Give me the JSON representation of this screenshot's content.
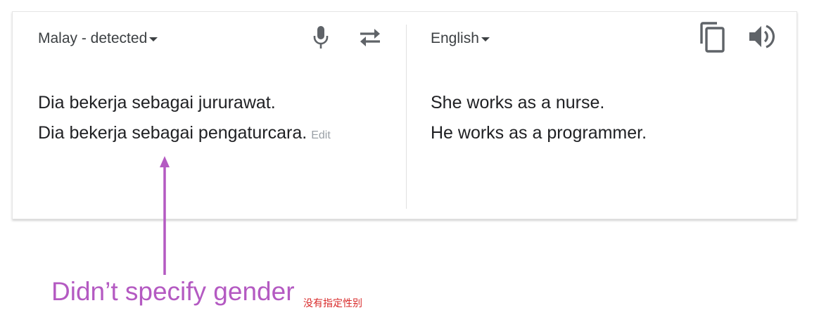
{
  "source": {
    "language_label": "Malay - detected",
    "lines": [
      "Dia bekerja sebagai jururawat.",
      "Dia bekerja sebagai pengaturcara."
    ],
    "edit_label": "Edit"
  },
  "target": {
    "language_label": "English",
    "lines": [
      "She works as a nurse.",
      "He works as a programmer."
    ]
  },
  "icons": {
    "microphone": "microphone-icon",
    "swap": "swap-languages-icon",
    "copy": "copy-icon",
    "speaker": "speaker-icon"
  },
  "annotation": {
    "text": "Didn’t specify gender",
    "subtext": "没有指定性别",
    "color": "#b45ac2",
    "subtext_color": "#d82a2a"
  },
  "colors": {
    "text": "#202124",
    "muted": "#9aa0a6",
    "icon": "#5f6368"
  }
}
